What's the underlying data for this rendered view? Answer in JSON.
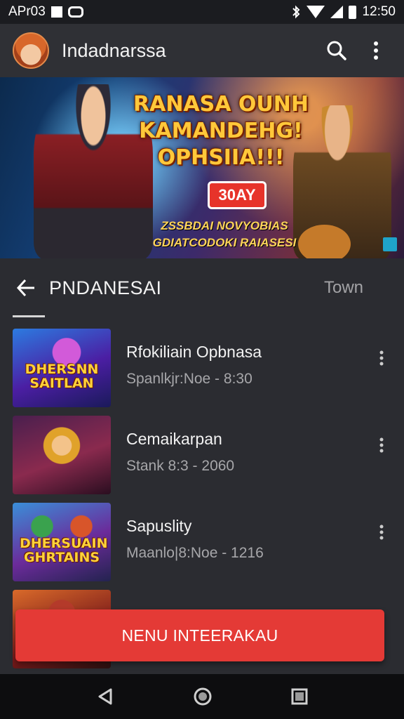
{
  "status_bar": {
    "time_left": "APr03",
    "time_right": "12:50"
  },
  "app_bar": {
    "title": "Indadnarssa",
    "icons": [
      "avatar",
      "search-icon",
      "more-vert-icon"
    ]
  },
  "banner": {
    "title_lines": [
      "RANASA OUNH",
      "KAMANDEHG!",
      "OPHSIIA!!!"
    ],
    "badge": "30AY",
    "sub_line_1": "ZSSBDAI  NOVYOBIAS",
    "sub_line_2": "GDIATCODOKI RAIASESI"
  },
  "section": {
    "back_icon": "arrow-left-icon",
    "title": "PNDANESAI",
    "tab": "Town"
  },
  "list": [
    {
      "title": "Rfokiliain Opbnasa",
      "meta": "Spanlkjr:Noe  -  8:30",
      "thumb_text": "DHERSNN SAITLAN"
    },
    {
      "title": "Cemaikarpan",
      "meta": "Stank 8:3  -  2060",
      "thumb_text": ""
    },
    {
      "title": "Sapuslity",
      "meta": "Maanlo|8:Noe  -  1216",
      "thumb_text": "DHERSUAIN GHRTAINS"
    },
    {
      "title": "",
      "meta": "",
      "thumb_text": ""
    }
  ],
  "cta": {
    "label": "NENU INTEERAKAU"
  },
  "nav": {
    "icons": [
      "back-triangle-icon",
      "home-circle-icon",
      "recents-square-icon"
    ]
  },
  "colors": {
    "accent": "#e43a36",
    "background": "#2b2c31",
    "app_bar": "#2f3035"
  }
}
